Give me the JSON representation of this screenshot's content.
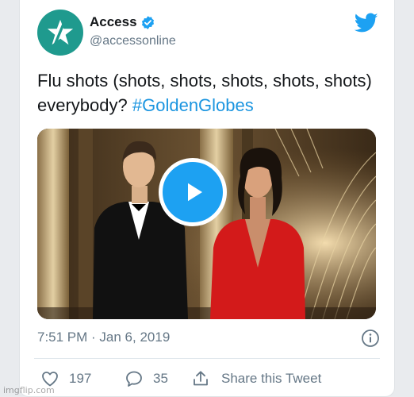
{
  "account": {
    "name": "Access",
    "handle": "@accessonline",
    "verified": true,
    "avatar_color": "#1f9a8e"
  },
  "tweet": {
    "text": "Flu shots (shots, shots, shots, shots, shots) everybody?",
    "hashtag": "#GoldenGlobes",
    "timestamp": "7:51 PM · Jan 6, 2019"
  },
  "media": {
    "type": "video",
    "play_icon": "play-icon"
  },
  "actions": {
    "likes": "197",
    "replies": "35",
    "share_label": "Share this Tweet"
  },
  "watermark": "imgflip.com",
  "colors": {
    "accent": "#1da1f2",
    "hashtag": "#1b95e0",
    "text": "#14171a",
    "muted": "#657786"
  }
}
